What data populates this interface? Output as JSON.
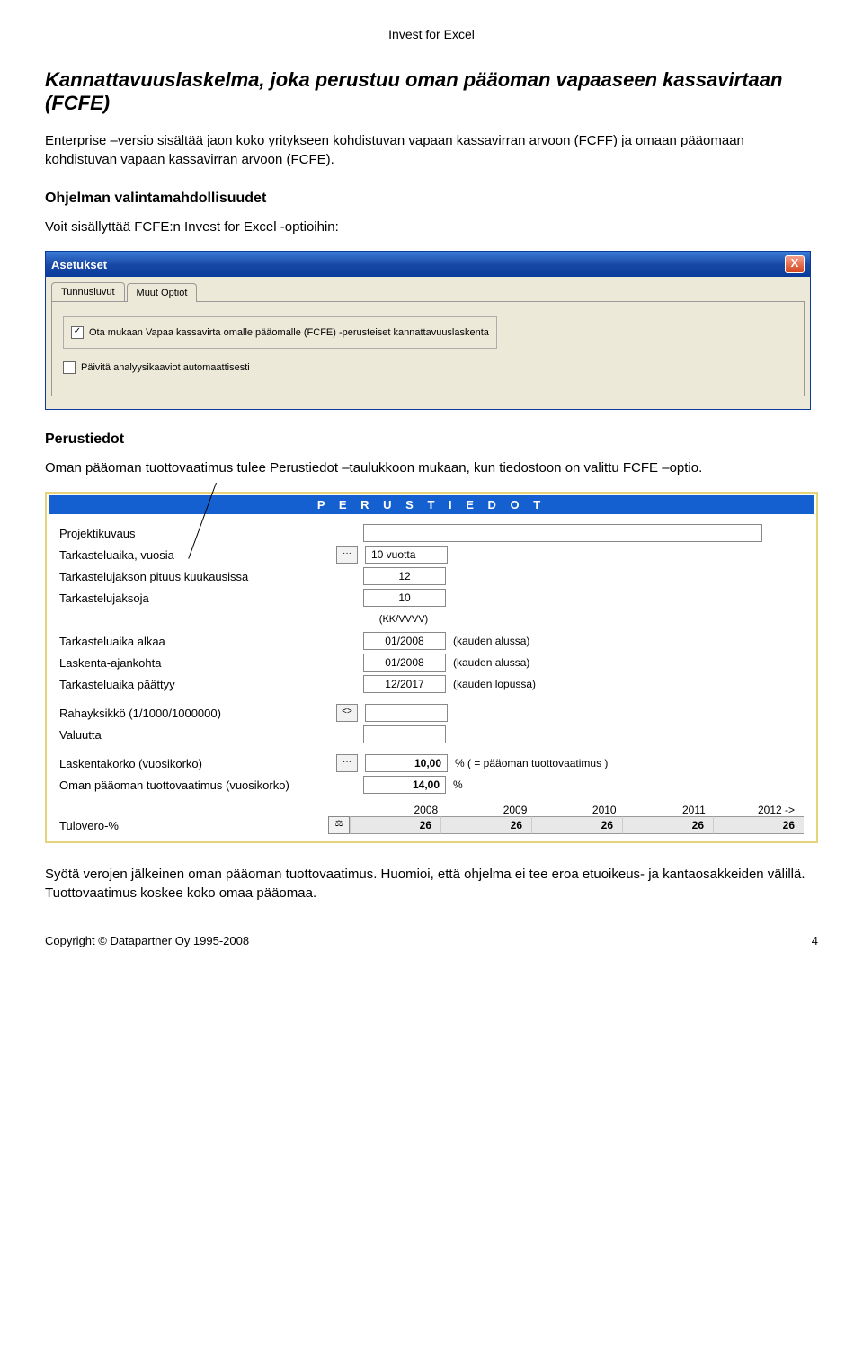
{
  "header": "Invest for Excel",
  "title": "Kannattavuuslaskelma, joka perustuu oman pääoman vapaaseen kassavirtaan (FCFE)",
  "intro": "Enterprise –versio sisältää jaon koko yritykseen kohdistuvan vapaan kassavirran arvoon (FCFF) ja omaan pääomaan kohdistuvan vapaan kassavirran arvoon (FCFE).",
  "s1": {
    "h": "Ohjelman valintamahdollisuudet",
    "p": "Voit sisällyttää FCFE:n Invest for Excel -optioihin:"
  },
  "dialog": {
    "title": "Asetukset",
    "close": "X",
    "tab1": "Tunnusluvut",
    "tab2": "Muut Optiot",
    "opt1": "Ota mukaan Vapaa kassavirta omalle pääomalle (FCFE) -perusteiset kannattavuuslaskenta",
    "opt2": "Päivitä analyysikaaviot automaattisesti"
  },
  "s2": {
    "h": "Perustiedot",
    "p": "Oman pääoman tuottovaatimus tulee Perustiedot –taulukkoon mukaan, kun tiedostoon on valittu FCFE –optio."
  },
  "pt": {
    "title": "P E R U S T I E D O T",
    "rows": {
      "projektikuvaus": "Projektikuvaus",
      "tarkasteluaika": "Tarkasteluaika, vuosia",
      "tarkasteluaika_v": "10 vuotta",
      "jaksonpituus": "Tarkastelujakson pituus kuukausissa",
      "jaksonpituus_v": "12",
      "jaksoja": "Tarkastelujaksoja",
      "jaksoja_v": "10",
      "kkvvvv": "(KK/VVVV)",
      "alkaa": "Tarkasteluaika alkaa",
      "alkaa_v": "01/2008",
      "alkaa_d": "(kauden alussa)",
      "ajankohta": "Laskenta-ajankohta",
      "ajankohta_v": "01/2008",
      "ajankohta_d": "(kauden alussa)",
      "paattyy": "Tarkasteluaika päättyy",
      "paattyy_v": "12/2017",
      "paattyy_d": "(kauden lopussa)",
      "rahayksikko": "Rahayksikkö (1/1000/1000000)",
      "valuutta": "Valuutta",
      "laskentakorko": "Laskentakorko (vuosikorko)",
      "laskentakorko_v": "10,00",
      "laskentakorko_d": "%   ( = pääoman tuottovaatimus )",
      "oman": "Oman pääoman tuottovaatimus (vuosikorko)",
      "oman_v": "14,00",
      "oman_d": "%",
      "tulovero": "Tulovero-%"
    },
    "years": [
      "2008",
      "2009",
      "2010",
      "2011",
      "2012 ->"
    ],
    "tulovero_vals": [
      "26",
      "26",
      "26",
      "26",
      "26"
    ],
    "btn_dots": "···",
    "btn_diamond": "<>",
    "btn_scale": "⚖"
  },
  "outro": "Syötä verojen jälkeinen oman pääoman tuottovaatimus. Huomioi, että ohjelma ei tee eroa etuoikeus- ja kantaosakkeiden välillä. Tuottovaatimus koskee koko omaa pääomaa.",
  "footer": {
    "left": "Copyright © Datapartner Oy 1995-2008",
    "right": "4"
  }
}
